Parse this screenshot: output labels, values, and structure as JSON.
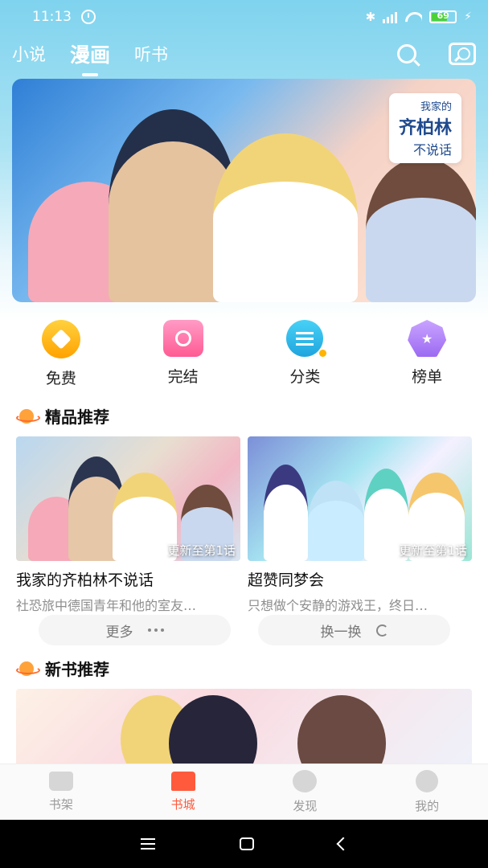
{
  "status_bar": {
    "time": "11:13",
    "battery": "69"
  },
  "header": {
    "tabs": [
      {
        "label": "小说",
        "active": false
      },
      {
        "label": "漫画",
        "active": true
      },
      {
        "label": "听书",
        "active": false
      }
    ]
  },
  "banner": {
    "title_line1": "我家的",
    "title_line2": "齐柏林",
    "title_line3": "不说话"
  },
  "quick_entries": [
    {
      "label": "免费",
      "icon": "diamond-icon"
    },
    {
      "label": "完结",
      "icon": "complete-icon"
    },
    {
      "label": "分类",
      "icon": "category-icon"
    },
    {
      "label": "榜单",
      "icon": "rank-icon"
    }
  ],
  "featured": {
    "title": "精品推荐",
    "cards": [
      {
        "title": "我家的齐柏林不说话",
        "desc": "社恐旅中德国青年和他的室友…",
        "caption": "更新至第1话"
      },
      {
        "title": "超赞同梦会",
        "desc": "只想做个安静的游戏王，终日…",
        "caption": "更新至第1话"
      }
    ],
    "more_label": "更多",
    "refresh_label": "换一换"
  },
  "new_books": {
    "title": "新书推荐"
  },
  "bottom_nav": [
    {
      "label": "书架",
      "active": false
    },
    {
      "label": "书城",
      "active": true
    },
    {
      "label": "发现",
      "active": false
    },
    {
      "label": "我的",
      "active": false
    }
  ],
  "colors": {
    "accent": "#ff5a3c",
    "sky": "#7fd3ee"
  }
}
